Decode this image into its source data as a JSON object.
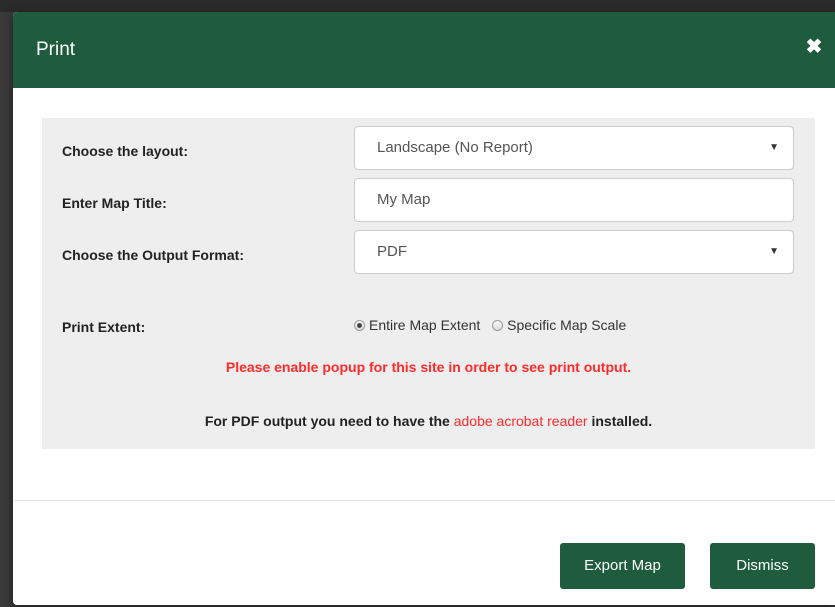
{
  "dialog": {
    "title": "Print",
    "close_icon": "close-icon",
    "close_glyph": "✖"
  },
  "form": {
    "layout_label": "Choose the layout:",
    "layout_value": "Landscape (No Report)",
    "map_title_label": "Enter Map Title:",
    "map_title_value": "My Map",
    "output_format_label": "Choose the Output Format:",
    "output_format_value": "PDF",
    "print_extent_label": "Print Extent:",
    "extent_options": [
      {
        "label": "Entire Map Extent",
        "checked": true
      },
      {
        "label": "Specific Map Scale",
        "checked": false
      }
    ],
    "popup_warning": "Please enable popup for this site in order to see print output.",
    "pdf_note_prefix": "For PDF output you need to have the ",
    "pdf_note_link": "adobe acrobat reader",
    "pdf_note_suffix": " installed."
  },
  "footer": {
    "export_label": "Export Map",
    "dismiss_label": "Dismiss"
  },
  "colors": {
    "header_green": "#1e5c3d",
    "warning_red": "#ff2b2b",
    "panel_gray": "#eeeeee"
  },
  "icons": {
    "select_caret": "chevron-down-icon"
  }
}
